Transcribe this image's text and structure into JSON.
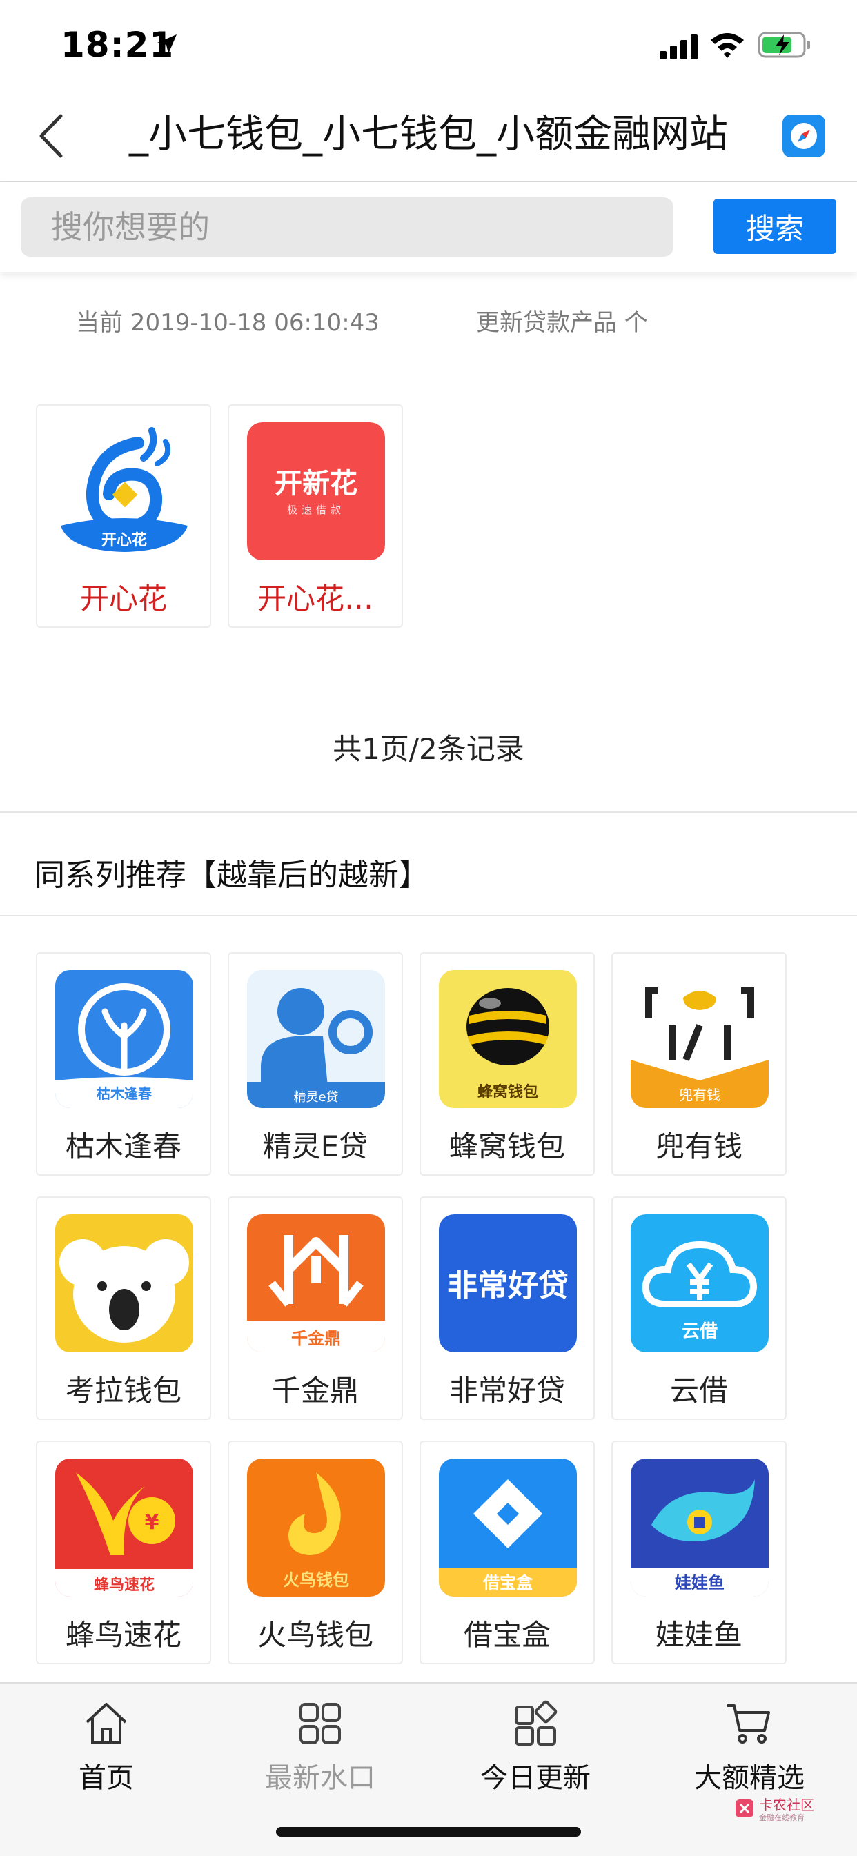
{
  "status_bar": {
    "time": "18:21"
  },
  "nav": {
    "title": "_小七钱包_小七钱包_小额金融网站"
  },
  "search": {
    "placeholder": "搜你想要的",
    "button_label": "搜索"
  },
  "info": {
    "current": "当前 2019-10-18 06:10:43",
    "update": "更新贷款产品 个"
  },
  "results": [
    {
      "label": "开心花",
      "icon_text": "开心花"
    },
    {
      "label": "开心花…",
      "icon_text": "开新花",
      "icon_sub": "极速借款"
    }
  ],
  "pagination": "共1页/2条记录",
  "section_title": "同系列推荐【越靠后的越新】",
  "recommend": [
    {
      "label": "枯木逢春",
      "icon_text": "枯木逢春"
    },
    {
      "label": "精灵E贷",
      "icon_text": "精灵e贷"
    },
    {
      "label": "蜂窝钱包",
      "icon_text": "蜂窝钱包"
    },
    {
      "label": "兜有钱",
      "icon_text": "兜有钱"
    },
    {
      "label": "考拉钱包"
    },
    {
      "label": "千金鼎",
      "icon_text": "千金鼎"
    },
    {
      "label": "非常好贷",
      "icon_text": "非常好贷"
    },
    {
      "label": "云借",
      "icon_text": "云借"
    },
    {
      "label": "蜂鸟速花",
      "icon_text": "蜂鸟速花"
    },
    {
      "label": "火鸟钱包",
      "icon_text": "火鸟钱包"
    },
    {
      "label": "借宝盒",
      "icon_text": "借宝盒"
    },
    {
      "label": "娃娃鱼",
      "icon_text": "娃娃鱼"
    }
  ],
  "tabs": [
    {
      "label": "首页",
      "icon": "home-icon"
    },
    {
      "label": "最新水口",
      "icon": "grid-icon"
    },
    {
      "label": "今日更新",
      "icon": "apps-icon"
    },
    {
      "label": "大额精选",
      "icon": "cart-icon"
    }
  ],
  "watermark": {
    "text": "卡农社区",
    "sub": "金融在线教育"
  },
  "colors": {
    "accent": "#0f7ef2",
    "result_label": "#d21f1f"
  }
}
